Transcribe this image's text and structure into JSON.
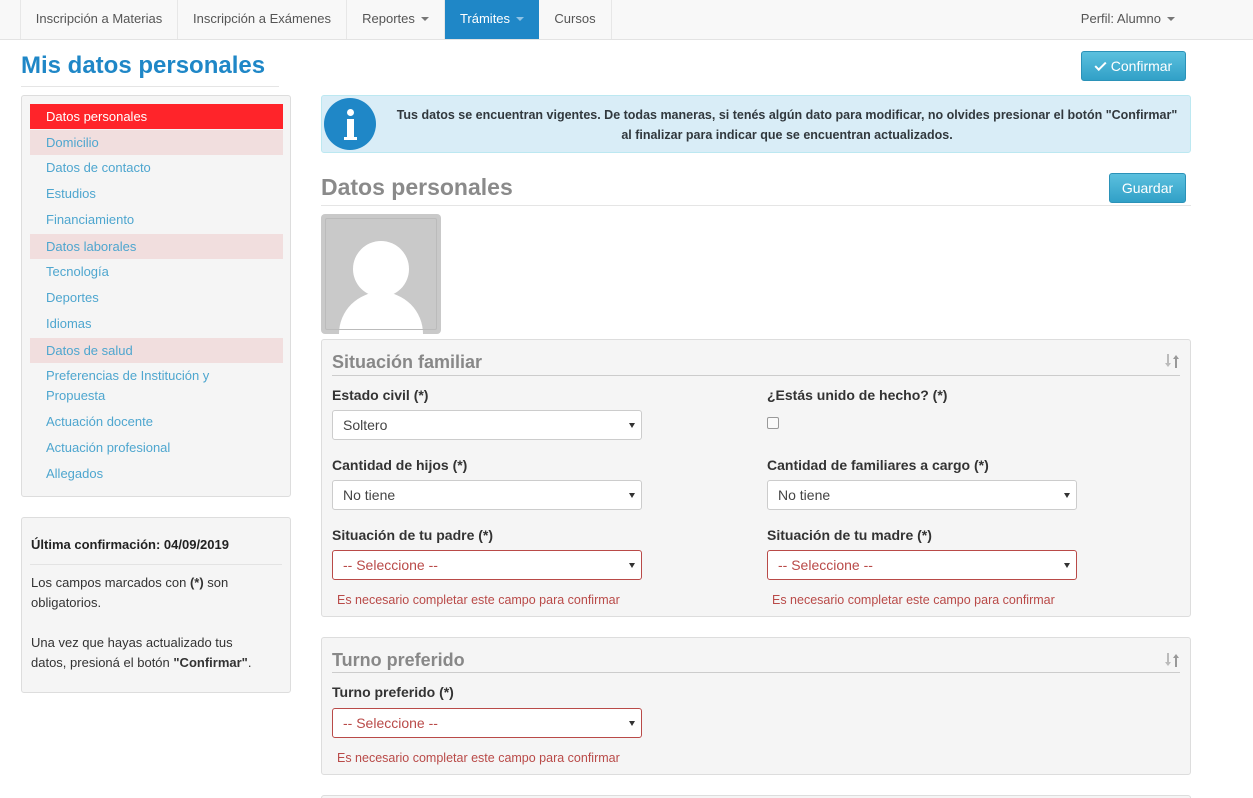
{
  "nav": {
    "items": [
      {
        "label": "Inscripción a Materias",
        "dropdown": false,
        "active": false
      },
      {
        "label": "Inscripción a Exámenes",
        "dropdown": false,
        "active": false
      },
      {
        "label": "Reportes",
        "dropdown": true,
        "active": false
      },
      {
        "label": "Trámites",
        "dropdown": true,
        "active": true
      },
      {
        "label": "Cursos",
        "dropdown": false,
        "active": false
      }
    ],
    "profile": "Perfil: Alumno"
  },
  "page": {
    "title": "Mis datos personales",
    "confirm_label": "Confirmar"
  },
  "sidebar": {
    "items": [
      {
        "label": "Datos personales",
        "state": "active"
      },
      {
        "label": "Domicilio",
        "state": "warn"
      },
      {
        "label": "Datos de contacto",
        "state": "plain"
      },
      {
        "label": "Estudios",
        "state": "plain"
      },
      {
        "label": "Financiamiento",
        "state": "plain"
      },
      {
        "label": "Datos laborales",
        "state": "warn"
      },
      {
        "label": "Tecnología",
        "state": "plain"
      },
      {
        "label": "Deportes",
        "state": "plain"
      },
      {
        "label": "Idiomas",
        "state": "plain"
      },
      {
        "label": "Datos de salud",
        "state": "warn"
      },
      {
        "label": "Preferencias de Institución y Propuesta",
        "state": "plain"
      },
      {
        "label": "Actuación docente",
        "state": "plain"
      },
      {
        "label": "Actuación profesional",
        "state": "plain"
      },
      {
        "label": "Allegados",
        "state": "plain"
      }
    ]
  },
  "info": {
    "last_confirmation": "Última confirmación: 04/09/2019",
    "required_pre": "Los campos marcados con ",
    "required_mark": "(*)",
    "required_post": " son obligatorios.",
    "update_pre": "Una vez que hayas actualizado tus datos, presioná el botón ",
    "update_btn": "\"Confirmar\"",
    "update_post": "."
  },
  "alert": {
    "text": "Tus datos se encuentran vigentes. De todas maneras, si tenés algún dato para modificar, no olvides presionar el botón \"Confirmar\" al finalizar para indicar que se encuentran actualizados."
  },
  "section": {
    "title": "Datos personales",
    "save_label": "Guardar"
  },
  "familiar": {
    "title": "Situación familiar",
    "estado_civil_label": "Estado civil (*)",
    "estado_civil_value": "Soltero",
    "unido_label": "¿Estás unido de hecho? (*)",
    "hijos_label": "Cantidad de hijos (*)",
    "hijos_value": "No tiene",
    "familiares_label": "Cantidad de familiares a cargo (*)",
    "familiares_value": "No tiene",
    "padre_label": "Situación de tu padre (*)",
    "padre_value": "-- Seleccione --",
    "madre_label": "Situación de tu madre (*)",
    "madre_value": "-- Seleccione --",
    "error_msg": "Es necesario completar este campo para confirmar"
  },
  "turno": {
    "title": "Turno preferido",
    "label": "Turno preferido (*)",
    "value": "-- Seleccione --",
    "error_msg": "Es necesario completar este campo para confirmar"
  }
}
